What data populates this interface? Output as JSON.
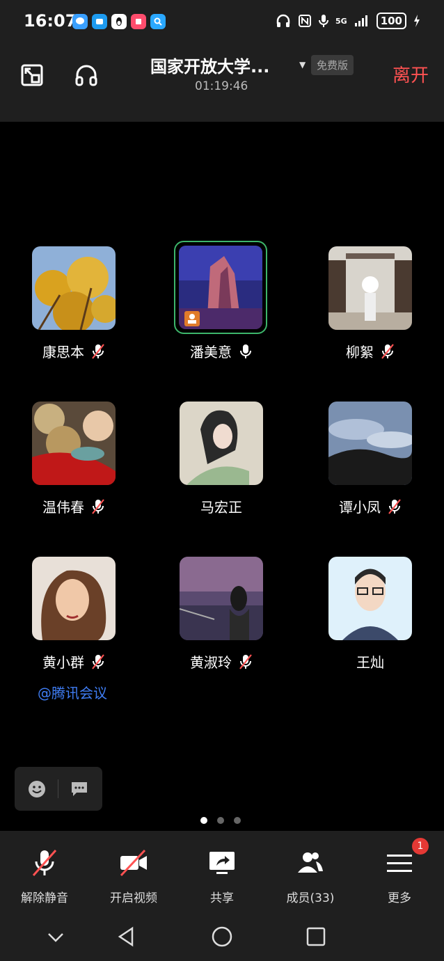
{
  "status_bar": {
    "time": "16:07",
    "icons": [
      "chat-bubble-icon",
      "message-icon",
      "penguin-icon",
      "app-icon",
      "search-app-icon"
    ],
    "network": "5G",
    "battery": "100"
  },
  "header": {
    "title": "国家开放大学...",
    "duration": "01:19:46",
    "plan_badge": "免费版",
    "leave_label": "离开"
  },
  "participants": [
    {
      "name": "康思本",
      "muted": true,
      "avatar": "yellow-flowers"
    },
    {
      "name": "潘美意",
      "muted": false,
      "speaking": true,
      "avatar": "mountain-sunset"
    },
    {
      "name": "柳絮",
      "muted": true,
      "avatar": "marshmello-figure"
    },
    {
      "name": "温伟春",
      "muted": true,
      "avatar": "food-fish"
    },
    {
      "name": "马宏正",
      "muted": null,
      "avatar": "painted-woman"
    },
    {
      "name": "谭小凤",
      "muted": true,
      "avatar": "cloudy-hills"
    },
    {
      "name": "黄小群",
      "muted": true,
      "avatar": "anime-woman"
    },
    {
      "name": "黄淑玲",
      "muted": true,
      "avatar": "girl-at-sunset"
    },
    {
      "name": "王灿",
      "muted": null,
      "avatar": "cartoon-man"
    }
  ],
  "mention_link": "@腾讯会议",
  "pagination": {
    "pages": 3,
    "current": 1
  },
  "toolbar": {
    "unmute": "解除静音",
    "start_video": "开启视频",
    "share": "共享",
    "members": "成员(33)",
    "more": "更多",
    "more_badge": "1"
  },
  "colors": {
    "accent_red": "#ff5252",
    "speaking_green": "#3db66b",
    "link_blue": "#3f7df3"
  }
}
